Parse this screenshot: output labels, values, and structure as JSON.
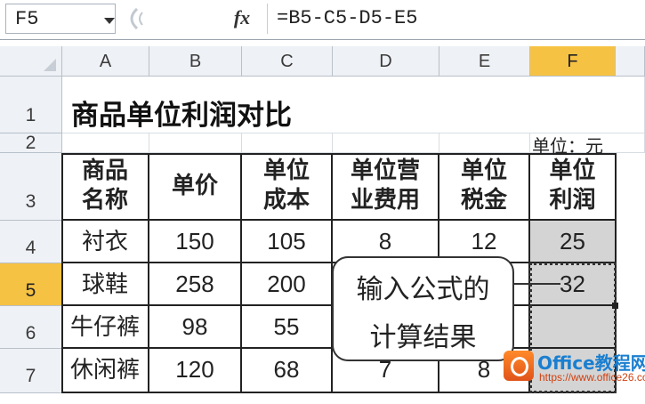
{
  "formula_bar": {
    "name_box": "F5",
    "fx_label": "fx",
    "formula": "=B5-C5-D5-E5"
  },
  "columns": [
    "A",
    "B",
    "C",
    "D",
    "E",
    "F"
  ],
  "rows": [
    "1",
    "2",
    "3",
    "4",
    "5",
    "6",
    "7"
  ],
  "sheet": {
    "title": "商品单位利润对比",
    "unit": "单位：元",
    "headers": [
      "商品名称",
      "单价",
      "单位成本",
      "单位营业费用",
      "单位税金",
      "单位利润"
    ],
    "header_lines": [
      [
        "商品",
        "名称"
      ],
      [
        "单价"
      ],
      [
        "单位",
        "成本"
      ],
      [
        "单位营",
        "业费用"
      ],
      [
        "单位",
        "税金"
      ],
      [
        "单位",
        "利润"
      ]
    ],
    "data": [
      [
        "衬衣",
        "150",
        "105",
        "8",
        "12",
        "25"
      ],
      [
        "球鞋",
        "258",
        "200",
        "",
        "",
        "32"
      ],
      [
        "牛仔裤",
        "98",
        "55",
        "",
        "",
        ""
      ],
      [
        "休闲裤",
        "120",
        "68",
        "7",
        "8",
        ""
      ]
    ]
  },
  "callout": {
    "line1": "输入公式的",
    "line2": "计算结果"
  },
  "watermark": {
    "title": "Office教程网",
    "url": "https://www.office26.com"
  }
}
